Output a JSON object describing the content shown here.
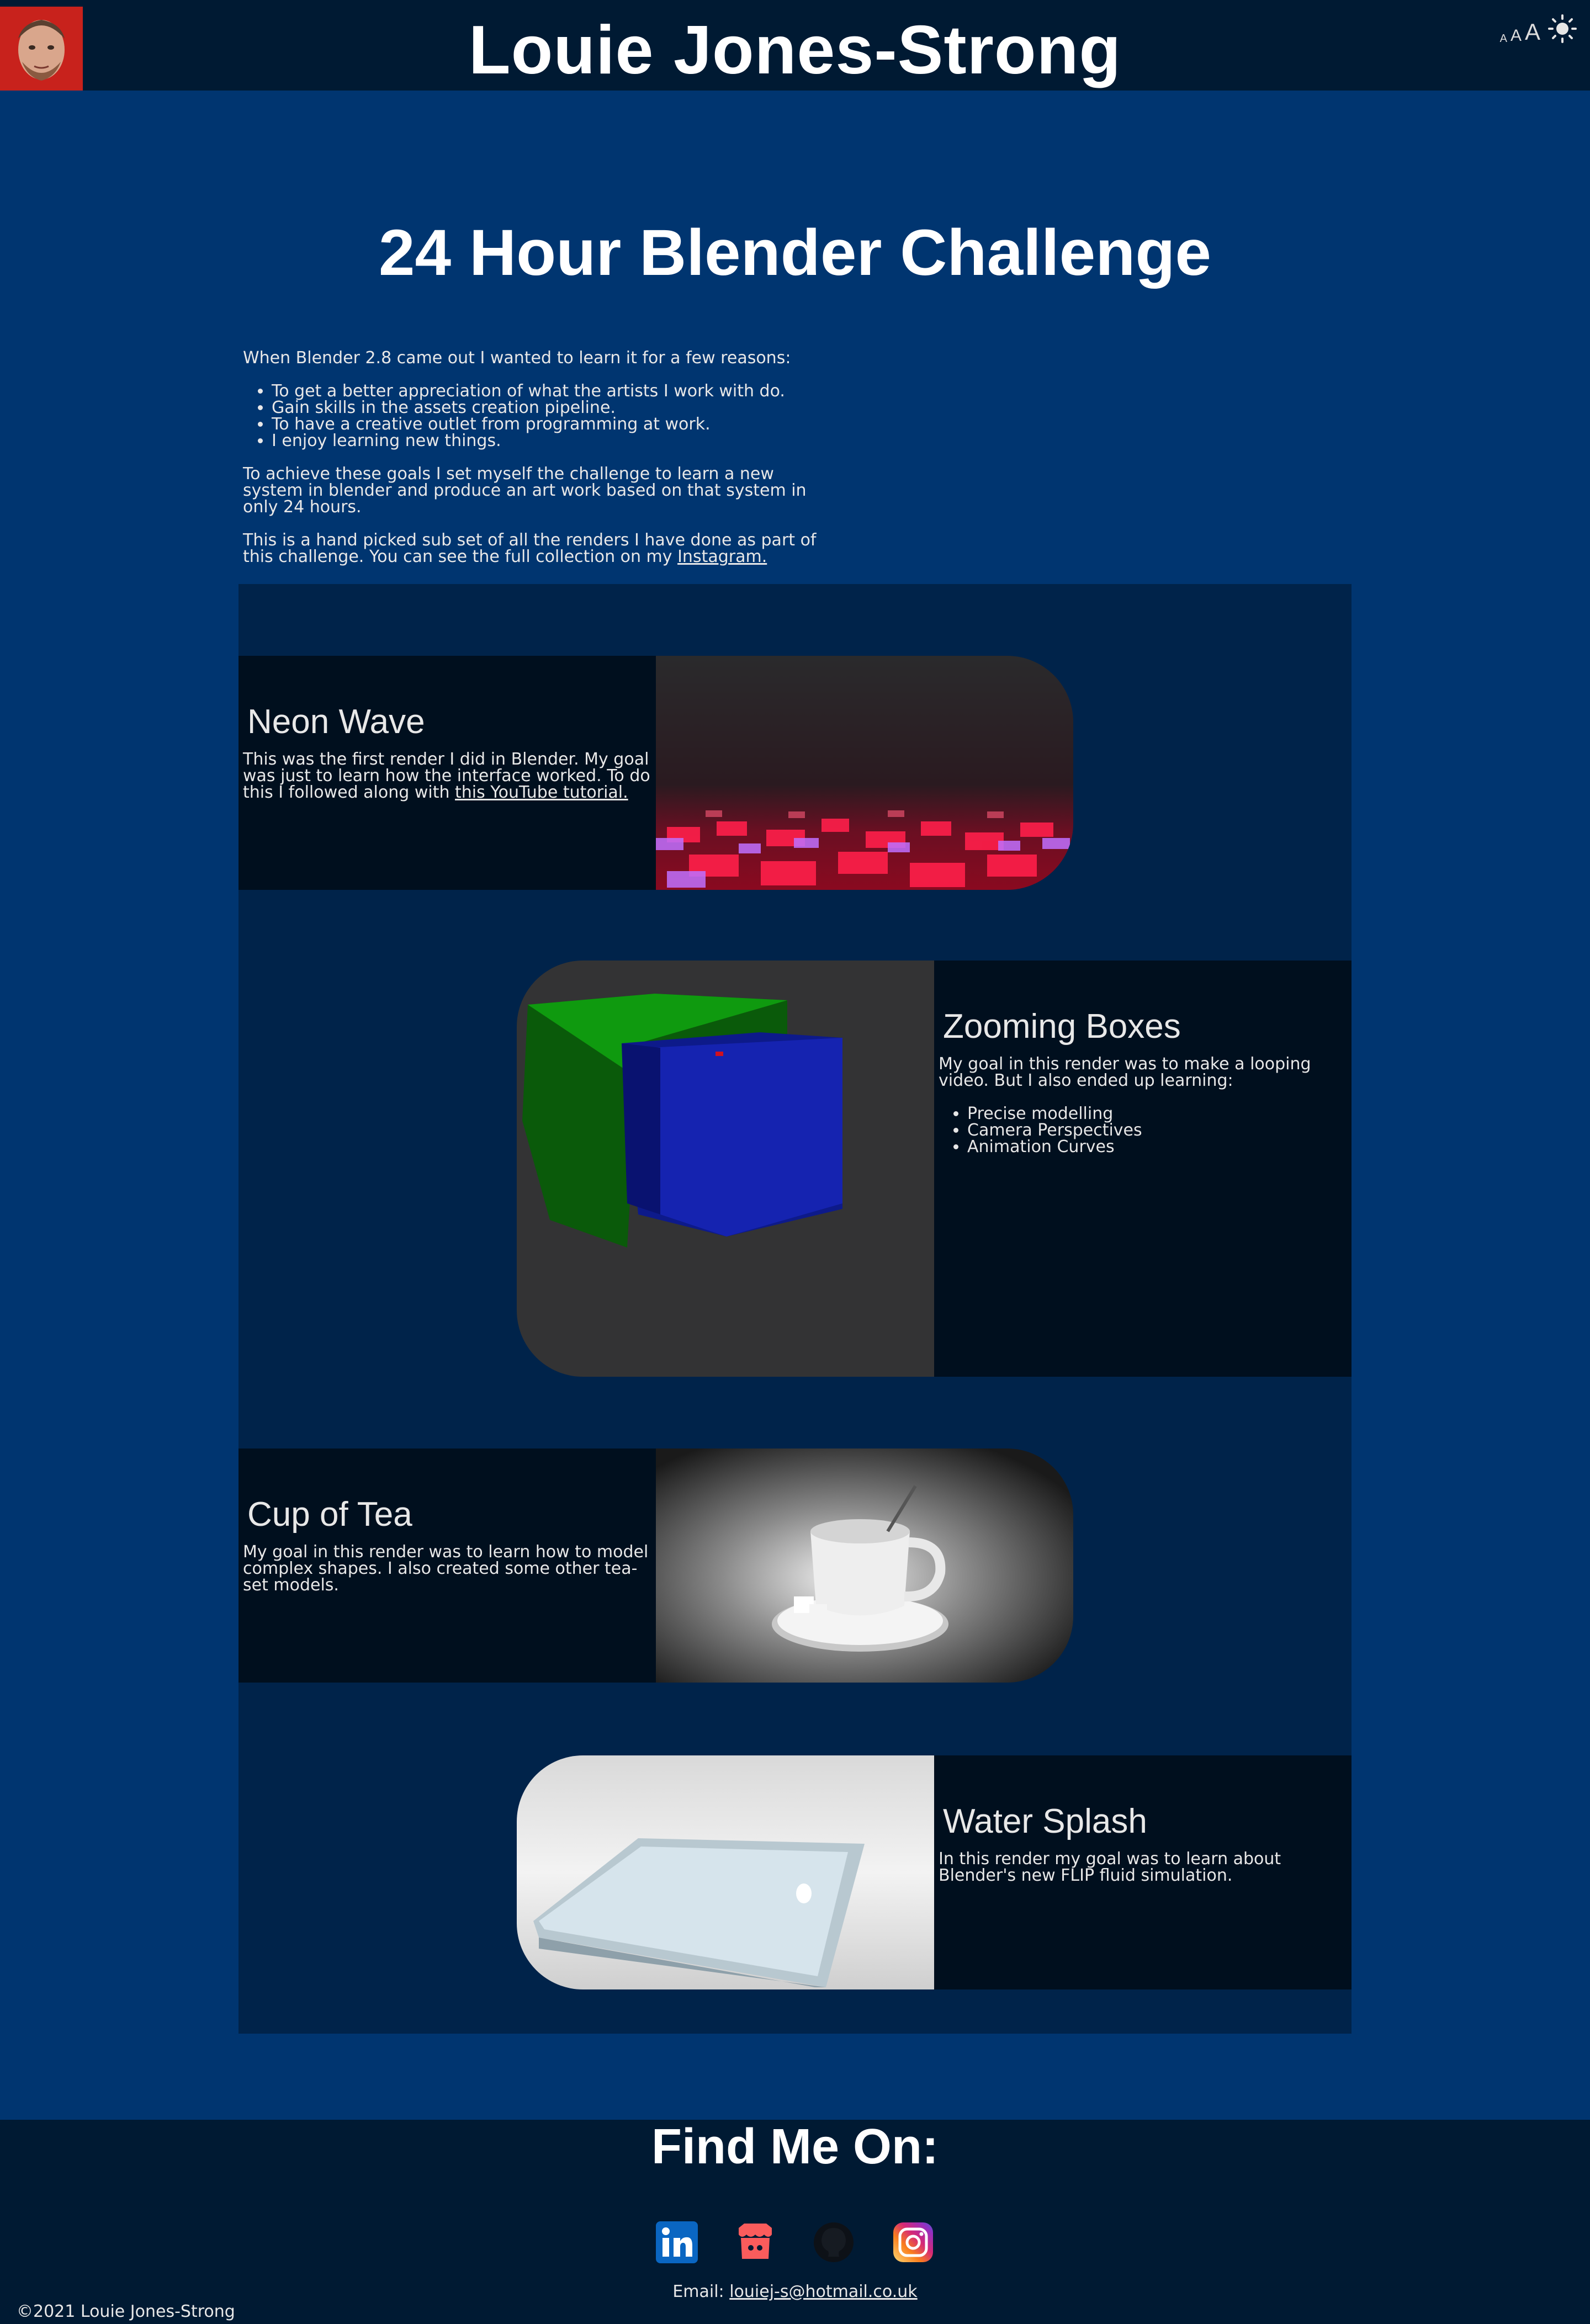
{
  "header": {
    "site_title": "Louie Jones-Strong",
    "font_small": "A",
    "font_medium": "A",
    "font_large": "A",
    "theme_toggle_icon": "sun-icon",
    "avatar_icon": "profile-photo"
  },
  "page": {
    "heading": "24 Hour Blender Challenge",
    "intro_lead": "When Blender 2.8 came out I wanted to learn it for a few reasons:",
    "reasons": [
      "To get a better appreciation of what the artists I work with do.",
      "Gain skills in the assets creation pipeline.",
      "To have a creative outlet from programming at work.",
      "I enjoy learning new things."
    ],
    "goal_text": "To achieve these goals I set myself the challenge to learn a new system in blender and produce an art work based on that system in only 24 hours.",
    "subset_text": "This is a hand picked sub set of all the renders I have done as part of this challenge. You can see the full collection on my ",
    "instagram_link": "Instagram."
  },
  "gallery": [
    {
      "title": "Neon Wave",
      "text": "This was the first render I did in Blender. My goal was just to learn how the interface worked. To do this I followed along with ",
      "link": "this YouTube tutorial."
    },
    {
      "title": "Zooming Boxes",
      "text": "My goal in this render was to make a looping video. But I also ended up learning:",
      "items": [
        "Precise modelling",
        "Camera Perspectives",
        "Animation Curves"
      ]
    },
    {
      "title": "Cup of Tea",
      "text": "My goal in this render was to learn how to model complex shapes. I also created some other tea-set models."
    },
    {
      "title": "Water Splash",
      "text": "In this render my goal was to learn about Blender's new FLIP fluid simulation."
    }
  ],
  "footer": {
    "heading": "Find Me On:",
    "socials": [
      {
        "icon": "linkedin-icon",
        "color": "#0a66c2"
      },
      {
        "icon": "itchio-icon",
        "color": "#fa5c5c"
      },
      {
        "icon": "github-icon",
        "color": "#161b22"
      },
      {
        "icon": "instagram-icon",
        "color": "#c13584"
      }
    ],
    "email_label": "Email: ",
    "email": "louiej-s@hotmail.co.uk",
    "copyright": "©2021 Louie Jones-Strong"
  },
  "colors": {
    "background": "#003570",
    "header_bg": "#001a33",
    "gallery_bg": "#00234a",
    "card_text_bg": "#000f1e"
  }
}
